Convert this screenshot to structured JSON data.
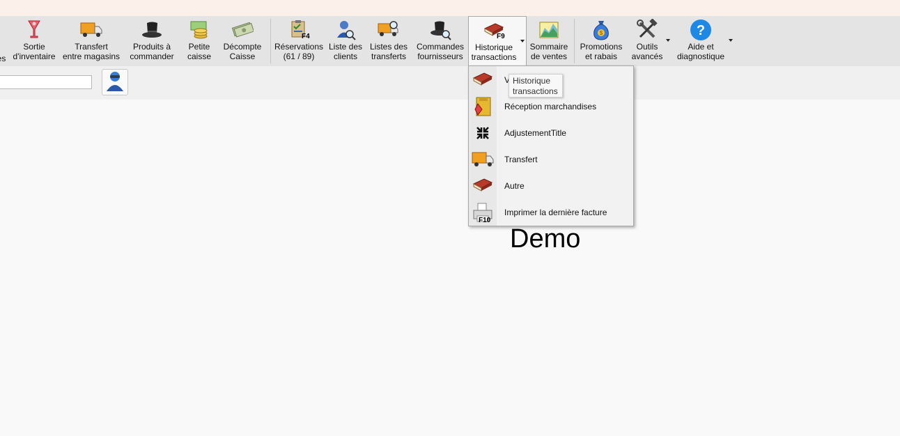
{
  "ribbon": {
    "items": [
      {
        "label": "es"
      },
      {
        "label": "Sortie\nd'inventaire",
        "icon": "cocktail-glass-icon"
      },
      {
        "label": "Transfert\nentre magasins",
        "icon": "delivery-truck-icon"
      },
      {
        "label": "Produits à\ncommander",
        "icon": "top-hat-icon"
      },
      {
        "label": "Petite\ncaisse",
        "icon": "coins-icon"
      },
      {
        "label": "Décompte\nCaisse",
        "icon": "cash-bills-icon"
      },
      {
        "label": "Réservations\n(61 / 89)",
        "icon": "clipboard-check-icon",
        "key": "F4"
      },
      {
        "label": "Liste des\nclients",
        "icon": "client-search-icon"
      },
      {
        "label": "Listes des\ntransferts",
        "icon": "truck-search-icon"
      },
      {
        "label": "Commandes\nfournisseurs",
        "icon": "hat-search-icon"
      },
      {
        "label": "Historique\ntransactions",
        "icon": "red-book-icon",
        "key": "F9"
      },
      {
        "label": "Sommaire\nde ventes",
        "icon": "sales-chart-icon"
      },
      {
        "label": "Promotions\net rabais",
        "icon": "money-bag-icon"
      },
      {
        "label": "Outils\navancés",
        "icon": "tools-icon"
      },
      {
        "label": "Aide et\ndiagnostique",
        "icon": "help-icon"
      }
    ]
  },
  "menu": {
    "items": [
      {
        "label": "V",
        "icon": "red-book-icon"
      },
      {
        "label": "Réception marchandises",
        "icon": "receiving-box-icon"
      },
      {
        "label": "AdjustementTitle",
        "icon": "adjust-arrows-icon"
      },
      {
        "label": "Transfert",
        "icon": "delivery-truck-icon"
      },
      {
        "label": "Autre",
        "icon": "red-book-icon"
      },
      {
        "label": "Imprimer la dernière facture",
        "icon": "printer-icon",
        "key": "F10"
      }
    ]
  },
  "tooltip": {
    "text": "Historique\ntransactions"
  },
  "main": {
    "store_name": "Demo"
  },
  "search": {
    "value": ""
  },
  "colors": {
    "titlebar": "#fbf1ea",
    "ribbon": "#e4e4e4",
    "menu": "#f2f2f2",
    "help": "#1e88e5"
  }
}
